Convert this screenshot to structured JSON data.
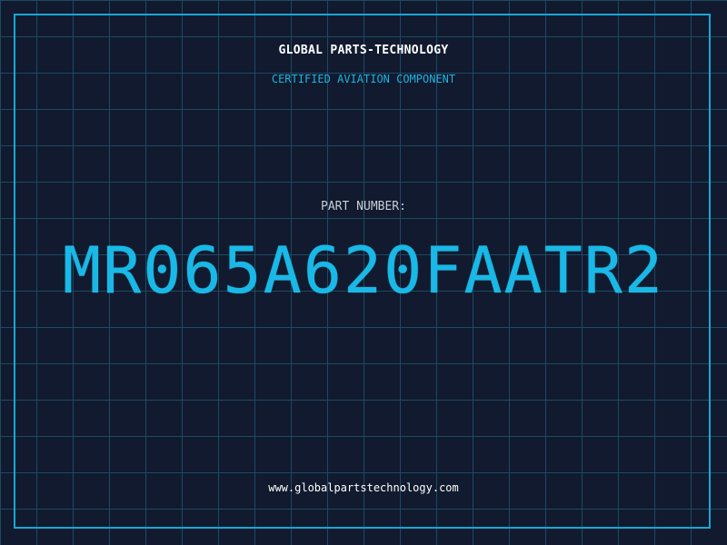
{
  "header": {
    "company": "GLOBAL PARTS-TECHNOLOGY",
    "tagline": "CERTIFIED AVIATION COMPONENT"
  },
  "main": {
    "part_label": "PART NUMBER:",
    "part_number": "MR065A620FAATR2"
  },
  "footer": {
    "website": "www.globalpartstechnology.com"
  },
  "colors": {
    "background": "#111a2e",
    "grid": "#1d4a63",
    "accent": "#1ab8e6",
    "frame": "#17a7d6",
    "text_primary": "#ffffff",
    "text_muted": "#c9cdd4"
  }
}
